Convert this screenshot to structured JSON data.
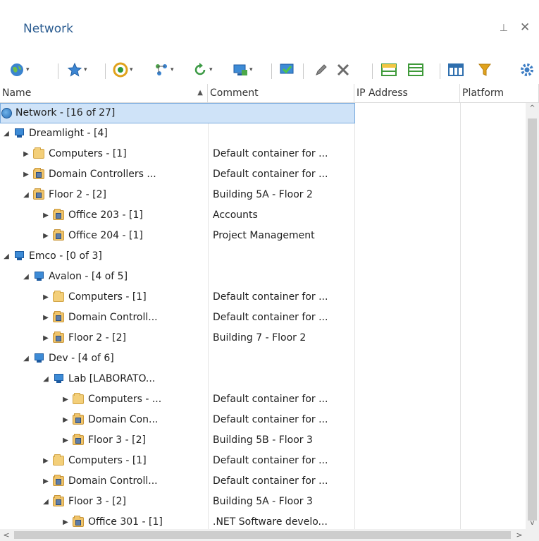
{
  "panel": {
    "title": "Network",
    "pin_glyph": "⊣",
    "close_glyph": "✕"
  },
  "toolbar": {
    "buttons": [
      {
        "name": "network-scope-button",
        "icon": "globe-icon",
        "dropdown": true
      },
      {
        "name": "favorites-button",
        "icon": "star-icon",
        "dropdown": true
      },
      {
        "name": "scan-button",
        "icon": "scan-icon",
        "dropdown": true
      },
      {
        "name": "discover-button",
        "icon": "nodes-icon",
        "dropdown": true
      },
      {
        "name": "refresh-button",
        "icon": "refresh-icon",
        "dropdown": true
      },
      {
        "name": "add-computer-button",
        "icon": "add-computer-icon",
        "dropdown": true
      },
      {
        "name": "check-button",
        "icon": "check-monitor-icon",
        "dropdown": false
      },
      {
        "name": "edit-button",
        "icon": "pencil-icon",
        "dropdown": false
      },
      {
        "name": "delete-button",
        "icon": "delete-icon",
        "dropdown": false
      },
      {
        "name": "group-button",
        "icon": "group-icon",
        "dropdown": false
      },
      {
        "name": "list-view-button",
        "icon": "list-icon",
        "dropdown": false
      },
      {
        "name": "columns-button",
        "icon": "columns-icon",
        "dropdown": false
      },
      {
        "name": "filter-button",
        "icon": "filter-icon",
        "dropdown": false
      },
      {
        "name": "settings-button",
        "icon": "gear-icon",
        "dropdown": false
      }
    ]
  },
  "columns": [
    {
      "label": "Name",
      "sorted": "asc"
    },
    {
      "label": "Comment"
    },
    {
      "label": "IP Address"
    },
    {
      "label": "Platform"
    }
  ],
  "rows": [
    {
      "depth": 0,
      "toggle": "",
      "icon": "globe",
      "name": "Network - [16 of 27]",
      "comment": "",
      "selected": true
    },
    {
      "depth": 0,
      "toggle": "◢",
      "icon": "domain",
      "name": "Dreamlight - [4]",
      "comment": ""
    },
    {
      "depth": 1,
      "toggle": "▶",
      "icon": "folder",
      "name": "Computers - [1]",
      "comment": "Default container for ..."
    },
    {
      "depth": 1,
      "toggle": "▶",
      "icon": "ou",
      "name": "Domain Controllers ...",
      "comment": "Default container for ..."
    },
    {
      "depth": 1,
      "toggle": "◢",
      "icon": "ou",
      "name": "Floor 2 - [2]",
      "comment": "Building 5A - Floor 2"
    },
    {
      "depth": 2,
      "toggle": "▶",
      "icon": "ou",
      "name": "Office 203 - [1]",
      "comment": "Accounts"
    },
    {
      "depth": 2,
      "toggle": "▶",
      "icon": "ou",
      "name": "Office 204 - [1]",
      "comment": "Project Management"
    },
    {
      "depth": 0,
      "toggle": "◢",
      "icon": "domain",
      "name": "Emco - [0 of 3]",
      "comment": ""
    },
    {
      "depth": 1,
      "toggle": "◢",
      "icon": "domain",
      "name": "Avalon - [4 of 5]",
      "comment": ""
    },
    {
      "depth": 2,
      "toggle": "▶",
      "icon": "folder",
      "name": "Computers - [1]",
      "comment": "Default container for ..."
    },
    {
      "depth": 2,
      "toggle": "▶",
      "icon": "ou",
      "name": "Domain Controll...",
      "comment": "Default container for ..."
    },
    {
      "depth": 2,
      "toggle": "▶",
      "icon": "ou",
      "name": "Floor 2 - [2]",
      "comment": "Building 7 - Floor 2"
    },
    {
      "depth": 1,
      "toggle": "◢",
      "icon": "domain",
      "name": "Dev - [4 of 6]",
      "comment": ""
    },
    {
      "depth": 2,
      "toggle": "◢",
      "icon": "domain",
      "name": "Lab [LABORATO...",
      "comment": ""
    },
    {
      "depth": 3,
      "toggle": "▶",
      "icon": "folder",
      "name": "Computers - ...",
      "comment": "Default container for ..."
    },
    {
      "depth": 3,
      "toggle": "▶",
      "icon": "ou",
      "name": "Domain Con...",
      "comment": "Default container for ..."
    },
    {
      "depth": 3,
      "toggle": "▶",
      "icon": "ou",
      "name": "Floor 3 - [2]",
      "comment": "Building 5B - Floor 3"
    },
    {
      "depth": 2,
      "toggle": "▶",
      "icon": "folder",
      "name": "Computers - [1]",
      "comment": "Default container for ..."
    },
    {
      "depth": 2,
      "toggle": "▶",
      "icon": "ou",
      "name": "Domain Controll...",
      "comment": "Default container for ..."
    },
    {
      "depth": 2,
      "toggle": "◢",
      "icon": "ou",
      "name": "Floor 3 - [2]",
      "comment": "Building 5A - Floor 3"
    },
    {
      "depth": 3,
      "toggle": "▶",
      "icon": "ou",
      "name": "Office 301 - [1]",
      "comment": ".NET Software develo..."
    }
  ],
  "colors": {
    "title": "#2c5d91",
    "selection": "#cfe3f8",
    "selection_border": "#7aabde"
  }
}
